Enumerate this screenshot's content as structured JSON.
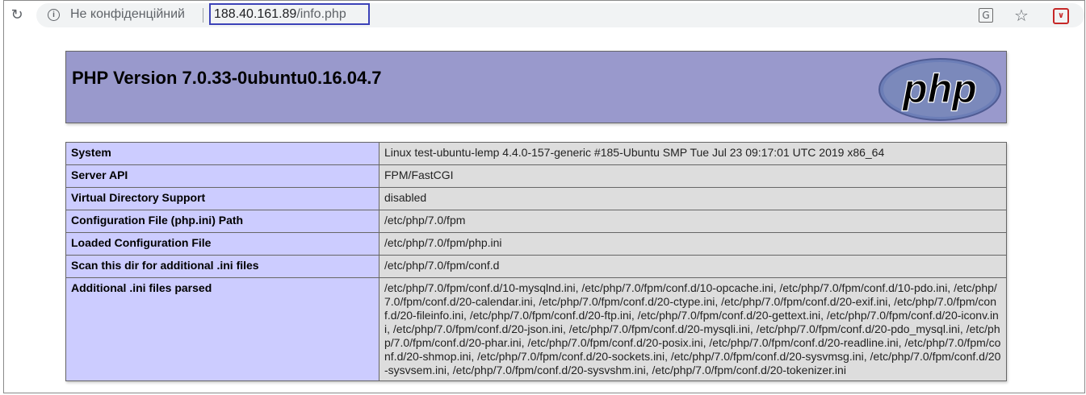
{
  "browser": {
    "not_secure_label": "Не конфіденційний",
    "url_host": "188.40.161.89",
    "url_path": "/info.php",
    "icons": {
      "reload": "reload-icon",
      "info": "info-icon",
      "translate": "translate-icon",
      "bookmark": "star-icon",
      "extension": "pocket-extension-icon"
    }
  },
  "page": {
    "title": "PHP Version 7.0.33-0ubuntu0.16.04.7",
    "logo_text": "php",
    "colors": {
      "header_bg": "#9999cc",
      "key_bg": "#ccccff",
      "value_bg": "#dddddd",
      "url_highlight_border": "#3c42b8"
    }
  },
  "rows": [
    {
      "key": "System",
      "value": "Linux test-ubuntu-lemp 4.4.0-157-generic #185-Ubuntu SMP Tue Jul 23 09:17:01 UTC 2019 x86_64"
    },
    {
      "key": "Server API",
      "value": "FPM/FastCGI"
    },
    {
      "key": "Virtual Directory Support",
      "value": "disabled"
    },
    {
      "key": "Configuration File (php.ini) Path",
      "value": "/etc/php/7.0/fpm"
    },
    {
      "key": "Loaded Configuration File",
      "value": "/etc/php/7.0/fpm/php.ini"
    },
    {
      "key": "Scan this dir for additional .ini files",
      "value": "/etc/php/7.0/fpm/conf.d"
    },
    {
      "key": "Additional .ini files parsed",
      "value": "/etc/php/7.0/fpm/conf.d/10-mysqlnd.ini, /etc/php/7.0/fpm/conf.d/10-opcache.ini, /etc/php/7.0/fpm/conf.d/10-pdo.ini, /etc/php/7.0/fpm/conf.d/20-calendar.ini, /etc/php/7.0/fpm/conf.d/20-ctype.ini, /etc/php/7.0/fpm/conf.d/20-exif.ini, /etc/php/7.0/fpm/conf.d/20-fileinfo.ini, /etc/php/7.0/fpm/conf.d/20-ftp.ini, /etc/php/7.0/fpm/conf.d/20-gettext.ini, /etc/php/7.0/fpm/conf.d/20-iconv.ini, /etc/php/7.0/fpm/conf.d/20-json.ini, /etc/php/7.0/fpm/conf.d/20-mysqli.ini, /etc/php/7.0/fpm/conf.d/20-pdo_mysql.ini, /etc/php/7.0/fpm/conf.d/20-phar.ini, /etc/php/7.0/fpm/conf.d/20-posix.ini, /etc/php/7.0/fpm/conf.d/20-readline.ini, /etc/php/7.0/fpm/conf.d/20-shmop.ini, /etc/php/7.0/fpm/conf.d/20-sockets.ini, /etc/php/7.0/fpm/conf.d/20-sysvmsg.ini, /etc/php/7.0/fpm/conf.d/20-sysvsem.ini, /etc/php/7.0/fpm/conf.d/20-sysvshm.ini, /etc/php/7.0/fpm/conf.d/20-tokenizer.ini"
    }
  ]
}
